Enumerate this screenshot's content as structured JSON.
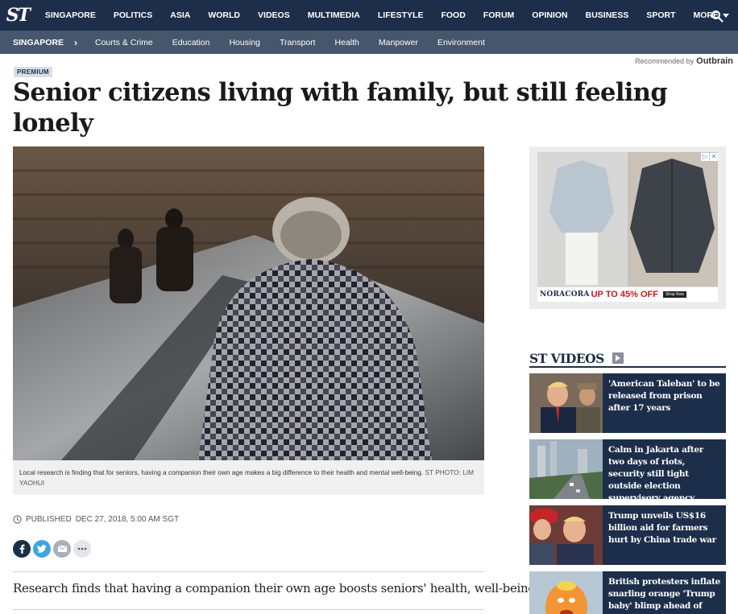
{
  "logo": {
    "text": "ST"
  },
  "topnav": {
    "items": [
      "SINGAPORE",
      "POLITICS",
      "ASIA",
      "WORLD",
      "VIDEOS",
      "MULTIMEDIA",
      "LIFESTYLE",
      "FOOD",
      "FORUM",
      "OPINION",
      "BUSINESS",
      "SPORT",
      "MORE"
    ],
    "search_icon": "search-icon"
  },
  "subnav": {
    "section": "SINGAPORE",
    "items": [
      "Courts & Crime",
      "Education",
      "Housing",
      "Transport",
      "Health",
      "Manpower",
      "Environment"
    ]
  },
  "outbrain": {
    "label": "Recommended by",
    "brand": "Outbrain"
  },
  "article": {
    "badge": "PREMIUM",
    "headline": "Senior citizens living with family, but still feeling lonely",
    "caption": "Local research is finding that for seniors, having a companion their own age makes a big difference to their health and mental well-being.",
    "credit": "ST PHOTO: LIM YAOHUI",
    "published_label": "PUBLISHED",
    "published_date": "DEC 27, 2018, 5:00 AM SGT",
    "standfirst": "Research finds that having a companion their own age boosts seniors' health, well-being"
  },
  "share": {
    "icons": [
      "facebook-icon",
      "twitter-icon",
      "email-icon",
      "more-icon"
    ]
  },
  "ad": {
    "brand": "NORACORA",
    "offer": "UP TO 45% OFF",
    "cta": "Shop Now"
  },
  "videos": {
    "heading": "ST VIDEOS",
    "items": [
      {
        "title": "'American Taleban' to be released from prison after 17 years"
      },
      {
        "title": "Calm in Jakarta after two days of riots, security still tight outside election supervisory agency"
      },
      {
        "title": "Trump unveils US$16 billion aid for farmers hurt by China trade war"
      },
      {
        "title": "British protesters inflate snarling orange 'Trump baby' blimp ahead of visit"
      }
    ]
  },
  "colors": {
    "nav": "#1c2e4a",
    "subnav": "#46566d",
    "accent_red": "#d0141e",
    "twitter": "#40a4e0"
  }
}
